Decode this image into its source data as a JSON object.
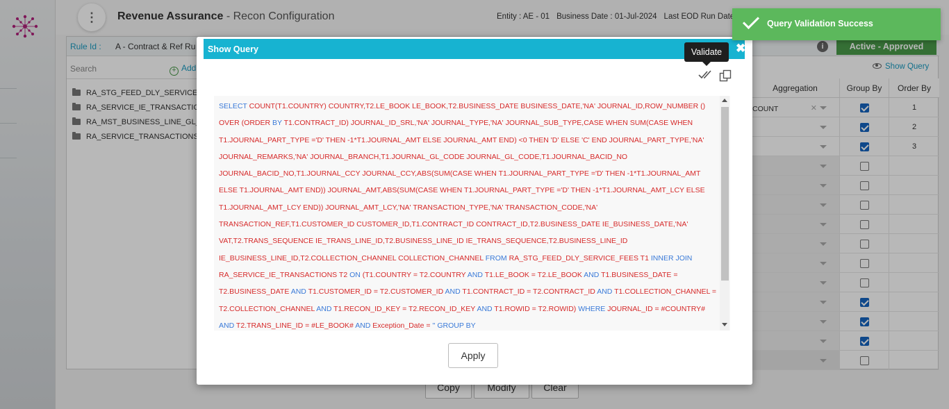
{
  "header": {
    "app_title": "Revenue Assurance",
    "page_subtitle": " - Recon Configuration",
    "entity_label": "Entity : ",
    "entity_value": "AE - 01",
    "business_date_label": "Business Date : ",
    "business_date_value": "01-Jul-2024",
    "eod_label": "Last EOD Run Date"
  },
  "rule": {
    "label": "Rule Id :",
    "value": "A - Contract & Ref Ru",
    "status": "Active - Approved"
  },
  "sidebar": {
    "search_placeholder": "Search",
    "add_label": "Add",
    "tree": [
      "RA_STG_FEED_DLY_SERVICE_FE",
      "RA_SERVICE_IE_TRANSACTIONS",
      "RA_MST_BUSINESS_LINE_GL_VW",
      "RA_SERVICE_TRANSACTIONS_JA"
    ]
  },
  "show_query_link": "Show Query",
  "grid": {
    "headers": [
      "Aggregation",
      "Group By",
      "Order By"
    ],
    "rows": [
      {
        "agg": "COUNT",
        "group": true,
        "order": "1"
      },
      {
        "agg": "",
        "group": true,
        "order": "2"
      },
      {
        "agg": "",
        "group": true,
        "order": "3"
      },
      {
        "agg": "",
        "group": false,
        "order": ""
      },
      {
        "agg": "",
        "group": false,
        "order": ""
      },
      {
        "agg": "",
        "group": false,
        "order": ""
      },
      {
        "agg": "",
        "group": false,
        "order": ""
      },
      {
        "agg": "",
        "group": false,
        "order": ""
      },
      {
        "agg": "",
        "group": false,
        "order": ""
      },
      {
        "agg": "",
        "group": false,
        "order": ""
      },
      {
        "agg": "",
        "group": true,
        "order": ""
      },
      {
        "agg": "",
        "group": true,
        "order": ""
      },
      {
        "agg": "",
        "group": true,
        "order": ""
      },
      {
        "agg": "",
        "group": false,
        "order": ""
      }
    ]
  },
  "bottom_buttons": {
    "copy": "Copy",
    "modify": "Modify",
    "clear": "Clear"
  },
  "modal": {
    "title": "Show Query",
    "tooltip": "Validate",
    "apply_label": "Apply",
    "query_tokens": [
      [
        "kw",
        "SELECT"
      ],
      [
        "t",
        " COUNT(T1.COUNTRY) COUNTRY,T2.LE_BOOK LE_BOOK,T2.BUSINESS_DATE BUSINESS_DATE,'NA' JOURNAL_ID,ROW_NUMBER () OVER (ORDER "
      ],
      [
        "kw",
        "BY"
      ],
      [
        "t",
        " T1.CONTRACT_ID) JOURNAL_ID_SRL,'NA' JOURNAL_TYPE,'NA' JOURNAL_SUB_TYPE,CASE WHEN SUM(CASE WHEN T1.JOURNAL_PART_TYPE ='D' THEN -1*T1.JOURNAL_AMT ELSE JOURNAL_AMT END) <0 THEN 'D' ELSE 'C' END JOURNAL_PART_TYPE,'NA' JOURNAL_REMARKS,'NA' JOURNAL_BRANCH,T1.JOURNAL_GL_CODE JOURNAL_GL_CODE,T1.JOURNAL_BACID_NO JOURNAL_BACID_NO,T1.JOURNAL_CCY JOURNAL_CCY,ABS(SUM(CASE WHEN T1.JOURNAL_PART_TYPE ='D' THEN -1*T1.JOURNAL_AMT ELSE T1.JOURNAL_AMT END)) JOURNAL_AMT,ABS(SUM(CASE WHEN T1.JOURNAL_PART_TYPE ='D' THEN -1*T1.JOURNAL_AMT_LCY ELSE T1.JOURNAL_AMT_LCY END)) JOURNAL_AMT_LCY,'NA' TRANSACTION_TYPE,'NA' TRANSACTION_CODE,'NA' TRANSACTION_REF,T1.CUSTOMER_ID CUSTOMER_ID,T1.CONTRACT_ID CONTRACT_ID,T2.BUSINESS_DATE IE_BUSINESS_DATE,'NA' VAT,T2.TRANS_SEQUENCE IE_TRANS_LINE_ID,T2.BUSINESS_LINE_ID IE_TRANS_SEQUENCE,T2.BUSINESS_LINE_ID IE_BUSINESS_LINE_ID,T2.COLLECTION_CHANNEL COLLECTION_CHANNEL "
      ],
      [
        "kw",
        "FROM"
      ],
      [
        "t",
        " RA_STG_FEED_DLY_SERVICE_FEES T1 "
      ],
      [
        "kw",
        "INNER"
      ],
      [
        "t",
        " "
      ],
      [
        "kw",
        "JOIN"
      ],
      [
        "t",
        " RA_SERVICE_IE_TRANSACTIONS T2 "
      ],
      [
        "kw",
        "ON"
      ],
      [
        "t",
        " (T1.COUNTRY = T2.COUNTRY "
      ],
      [
        "kw",
        "AND"
      ],
      [
        "t",
        " T1.LE_BOOK = T2.LE_BOOK "
      ],
      [
        "kw",
        "AND"
      ],
      [
        "t",
        " T1.BUSINESS_DATE = T2.BUSINESS_DATE "
      ],
      [
        "kw",
        "AND"
      ],
      [
        "t",
        " T1.CUSTOMER_ID = T2.CUSTOMER_ID "
      ],
      [
        "kw",
        "AND"
      ],
      [
        "t",
        " T1.CONTRACT_ID = T2.CONTRACT_ID "
      ],
      [
        "kw",
        "AND"
      ],
      [
        "t",
        " T1.COLLECTION_CHANNEL = T2.COLLECTION_CHANNEL "
      ],
      [
        "kw",
        "AND"
      ],
      [
        "t",
        " T1.RECON_ID_KEY = T2.RECON_ID_KEY "
      ],
      [
        "kw",
        "AND"
      ],
      [
        "t",
        " T1.ROWID = T2.ROWID) "
      ],
      [
        "kw",
        "WHERE"
      ],
      [
        "t",
        " JOURNAL_ID = #COUNTRY# "
      ],
      [
        "kw",
        "AND"
      ],
      [
        "t",
        " T2.TRANS_LINE_ID = #LE_BOOK# "
      ],
      [
        "kw",
        "AND"
      ],
      [
        "t",
        " Exception_Date = "
      ],
      [
        "kw",
        "''"
      ],
      [
        "t",
        " "
      ],
      [
        "kw",
        "GROUP"
      ],
      [
        "t",
        " "
      ],
      [
        "kw",
        "BY"
      ]
    ]
  },
  "toast": {
    "message": "Query Validation Success"
  },
  "colors": {
    "accent": "#17b3d1",
    "keyword": "#3a7ad8",
    "query_text": "#d62a2a",
    "success": "#5cb85c",
    "status_badge": "#4a9a4a"
  }
}
